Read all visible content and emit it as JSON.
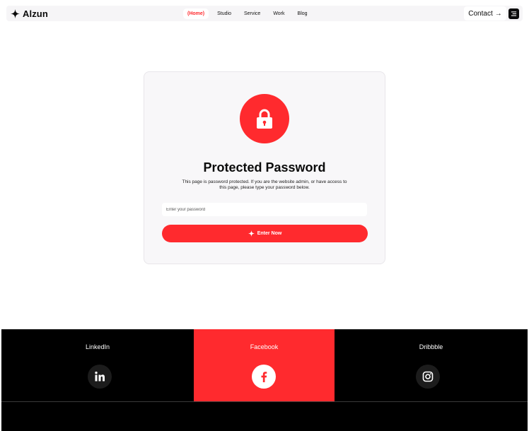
{
  "header": {
    "logo_text": "Alzun",
    "nav": [
      {
        "label": "(Home)",
        "active": true
      },
      {
        "label": "Studio",
        "active": false
      },
      {
        "label": "Service",
        "active": false
      },
      {
        "label": "Work",
        "active": false
      },
      {
        "label": "Blog",
        "active": false
      }
    ],
    "contact_label": "Contact",
    "contact_arrow": "→"
  },
  "card": {
    "icon": "lock-icon",
    "title": "Protected Password",
    "description": "This page is password protected. If you are the website admin, or have access to this page, please type your password below.",
    "password_placeholder": "Enter your password",
    "button_label": "Enter Now",
    "button_icon": "sparkle-icon"
  },
  "footer": {
    "socials": [
      {
        "label": "LinkedIn",
        "icon": "linkedin-icon",
        "highlighted": false
      },
      {
        "label": "Facebook",
        "icon": "facebook-icon",
        "highlighted": true
      },
      {
        "label": "Dribbble",
        "icon": "instagram-icon",
        "highlighted": false
      }
    ]
  },
  "colors": {
    "accent": "#ff2a2e",
    "dark": "#0b0b0b",
    "card_bg": "#f8f7f9",
    "footer_bg": "#000000"
  }
}
